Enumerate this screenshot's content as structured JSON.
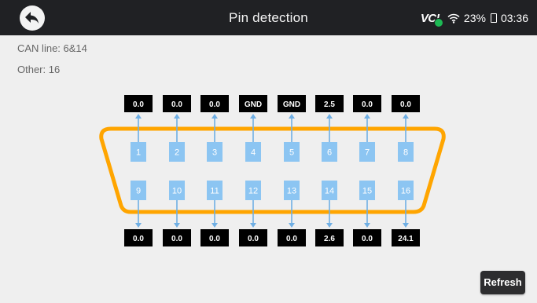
{
  "header": {
    "title": "Pin detection",
    "status": {
      "vci_label": "VC!",
      "battery": "23%",
      "time": "03:36"
    }
  },
  "info": {
    "can_line": "CAN line: 6&14",
    "other": "Other: 16"
  },
  "connector": {
    "top_pins": [
      {
        "pin": "1",
        "value": "0.0"
      },
      {
        "pin": "2",
        "value": "0.0"
      },
      {
        "pin": "3",
        "value": "0.0"
      },
      {
        "pin": "4",
        "value": "GND"
      },
      {
        "pin": "5",
        "value": "GND"
      },
      {
        "pin": "6",
        "value": "2.5"
      },
      {
        "pin": "7",
        "value": "0.0"
      },
      {
        "pin": "8",
        "value": "0.0"
      }
    ],
    "bottom_pins": [
      {
        "pin": "9",
        "value": "0.0"
      },
      {
        "pin": "10",
        "value": "0.0"
      },
      {
        "pin": "11",
        "value": "0.0"
      },
      {
        "pin": "12",
        "value": "0.0"
      },
      {
        "pin": "13",
        "value": "0.0"
      },
      {
        "pin": "14",
        "value": "2.6"
      },
      {
        "pin": "15",
        "value": "0.0"
      },
      {
        "pin": "16",
        "value": "24.1"
      }
    ]
  },
  "actions": {
    "refresh_label": "Refresh"
  },
  "colors": {
    "connector_outline": "#FFA500",
    "pin_fill": "#8CC5F2",
    "arrow": "#6FAFE4",
    "value_box": "#000000",
    "header_bg": "#202124"
  },
  "icons": {
    "back": "back-arrow-icon",
    "wifi": "wifi-icon",
    "battery": "battery-icon",
    "vci_connected": "check-icon"
  }
}
